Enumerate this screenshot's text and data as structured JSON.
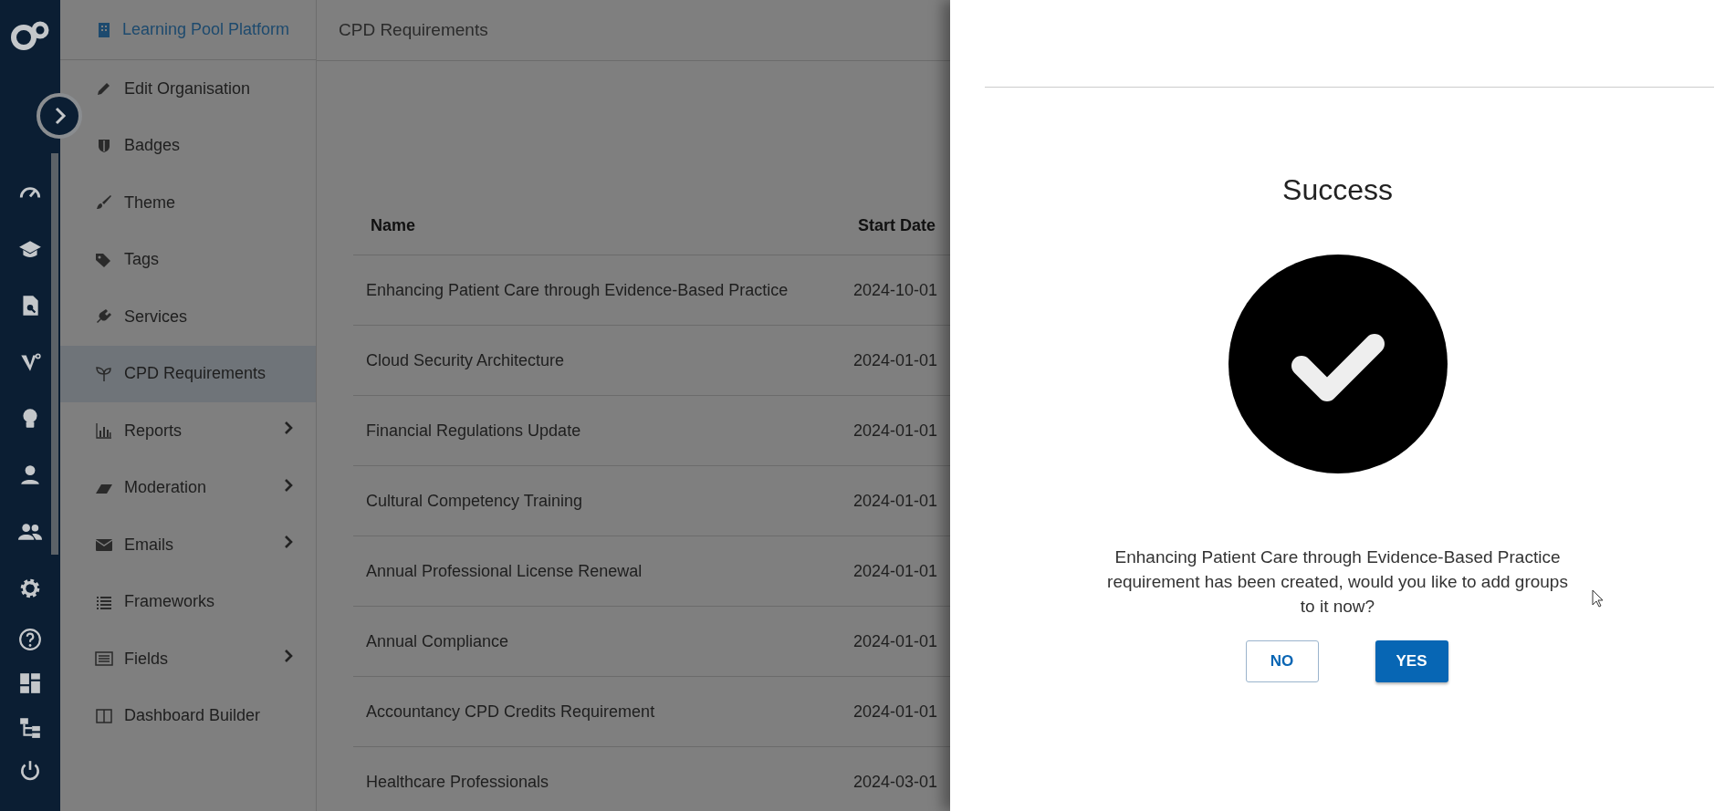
{
  "sidebar": {
    "header": "Learning Pool Platform",
    "items": [
      {
        "label": "Edit Organisation",
        "selected": false,
        "expandable": false
      },
      {
        "label": "Badges",
        "selected": false,
        "expandable": false
      },
      {
        "label": "Theme",
        "selected": false,
        "expandable": false
      },
      {
        "label": "Tags",
        "selected": false,
        "expandable": false
      },
      {
        "label": "Services",
        "selected": false,
        "expandable": false
      },
      {
        "label": "CPD Requirements",
        "selected": true,
        "expandable": false
      },
      {
        "label": "Reports",
        "selected": false,
        "expandable": true
      },
      {
        "label": "Moderation",
        "selected": false,
        "expandable": true
      },
      {
        "label": "Emails",
        "selected": false,
        "expandable": true
      },
      {
        "label": "Frameworks",
        "selected": false,
        "expandable": false
      },
      {
        "label": "Fields",
        "selected": false,
        "expandable": true
      },
      {
        "label": "Dashboard Builder",
        "selected": false,
        "expandable": false
      }
    ]
  },
  "page_title": "CPD Requirements",
  "table": {
    "columns": [
      "Name",
      "Start Date"
    ],
    "rows": [
      [
        "Enhancing Patient Care through Evidence-Based Practice",
        "2024-10-01"
      ],
      [
        "Cloud Security Architecture",
        "2024-01-01"
      ],
      [
        "Financial Regulations Update",
        "2024-01-01"
      ],
      [
        "Cultural Competency Training",
        "2024-01-01"
      ],
      [
        "Annual Professional License Renewal",
        "2024-01-01"
      ],
      [
        "Annual Compliance",
        "2024-01-01"
      ],
      [
        "Accountancy CPD Credits Requirement",
        "2024-01-01"
      ],
      [
        "Healthcare Professionals",
        "2024-03-01"
      ]
    ]
  },
  "dialog": {
    "title": "Success",
    "message": "Enhancing Patient Care through Evidence-Based Practice requirement has been created, would you like to add groups to it now?",
    "buttons": [
      {
        "label": "NO",
        "kind": "secondary"
      },
      {
        "label": "YES",
        "kind": "primary"
      }
    ]
  }
}
